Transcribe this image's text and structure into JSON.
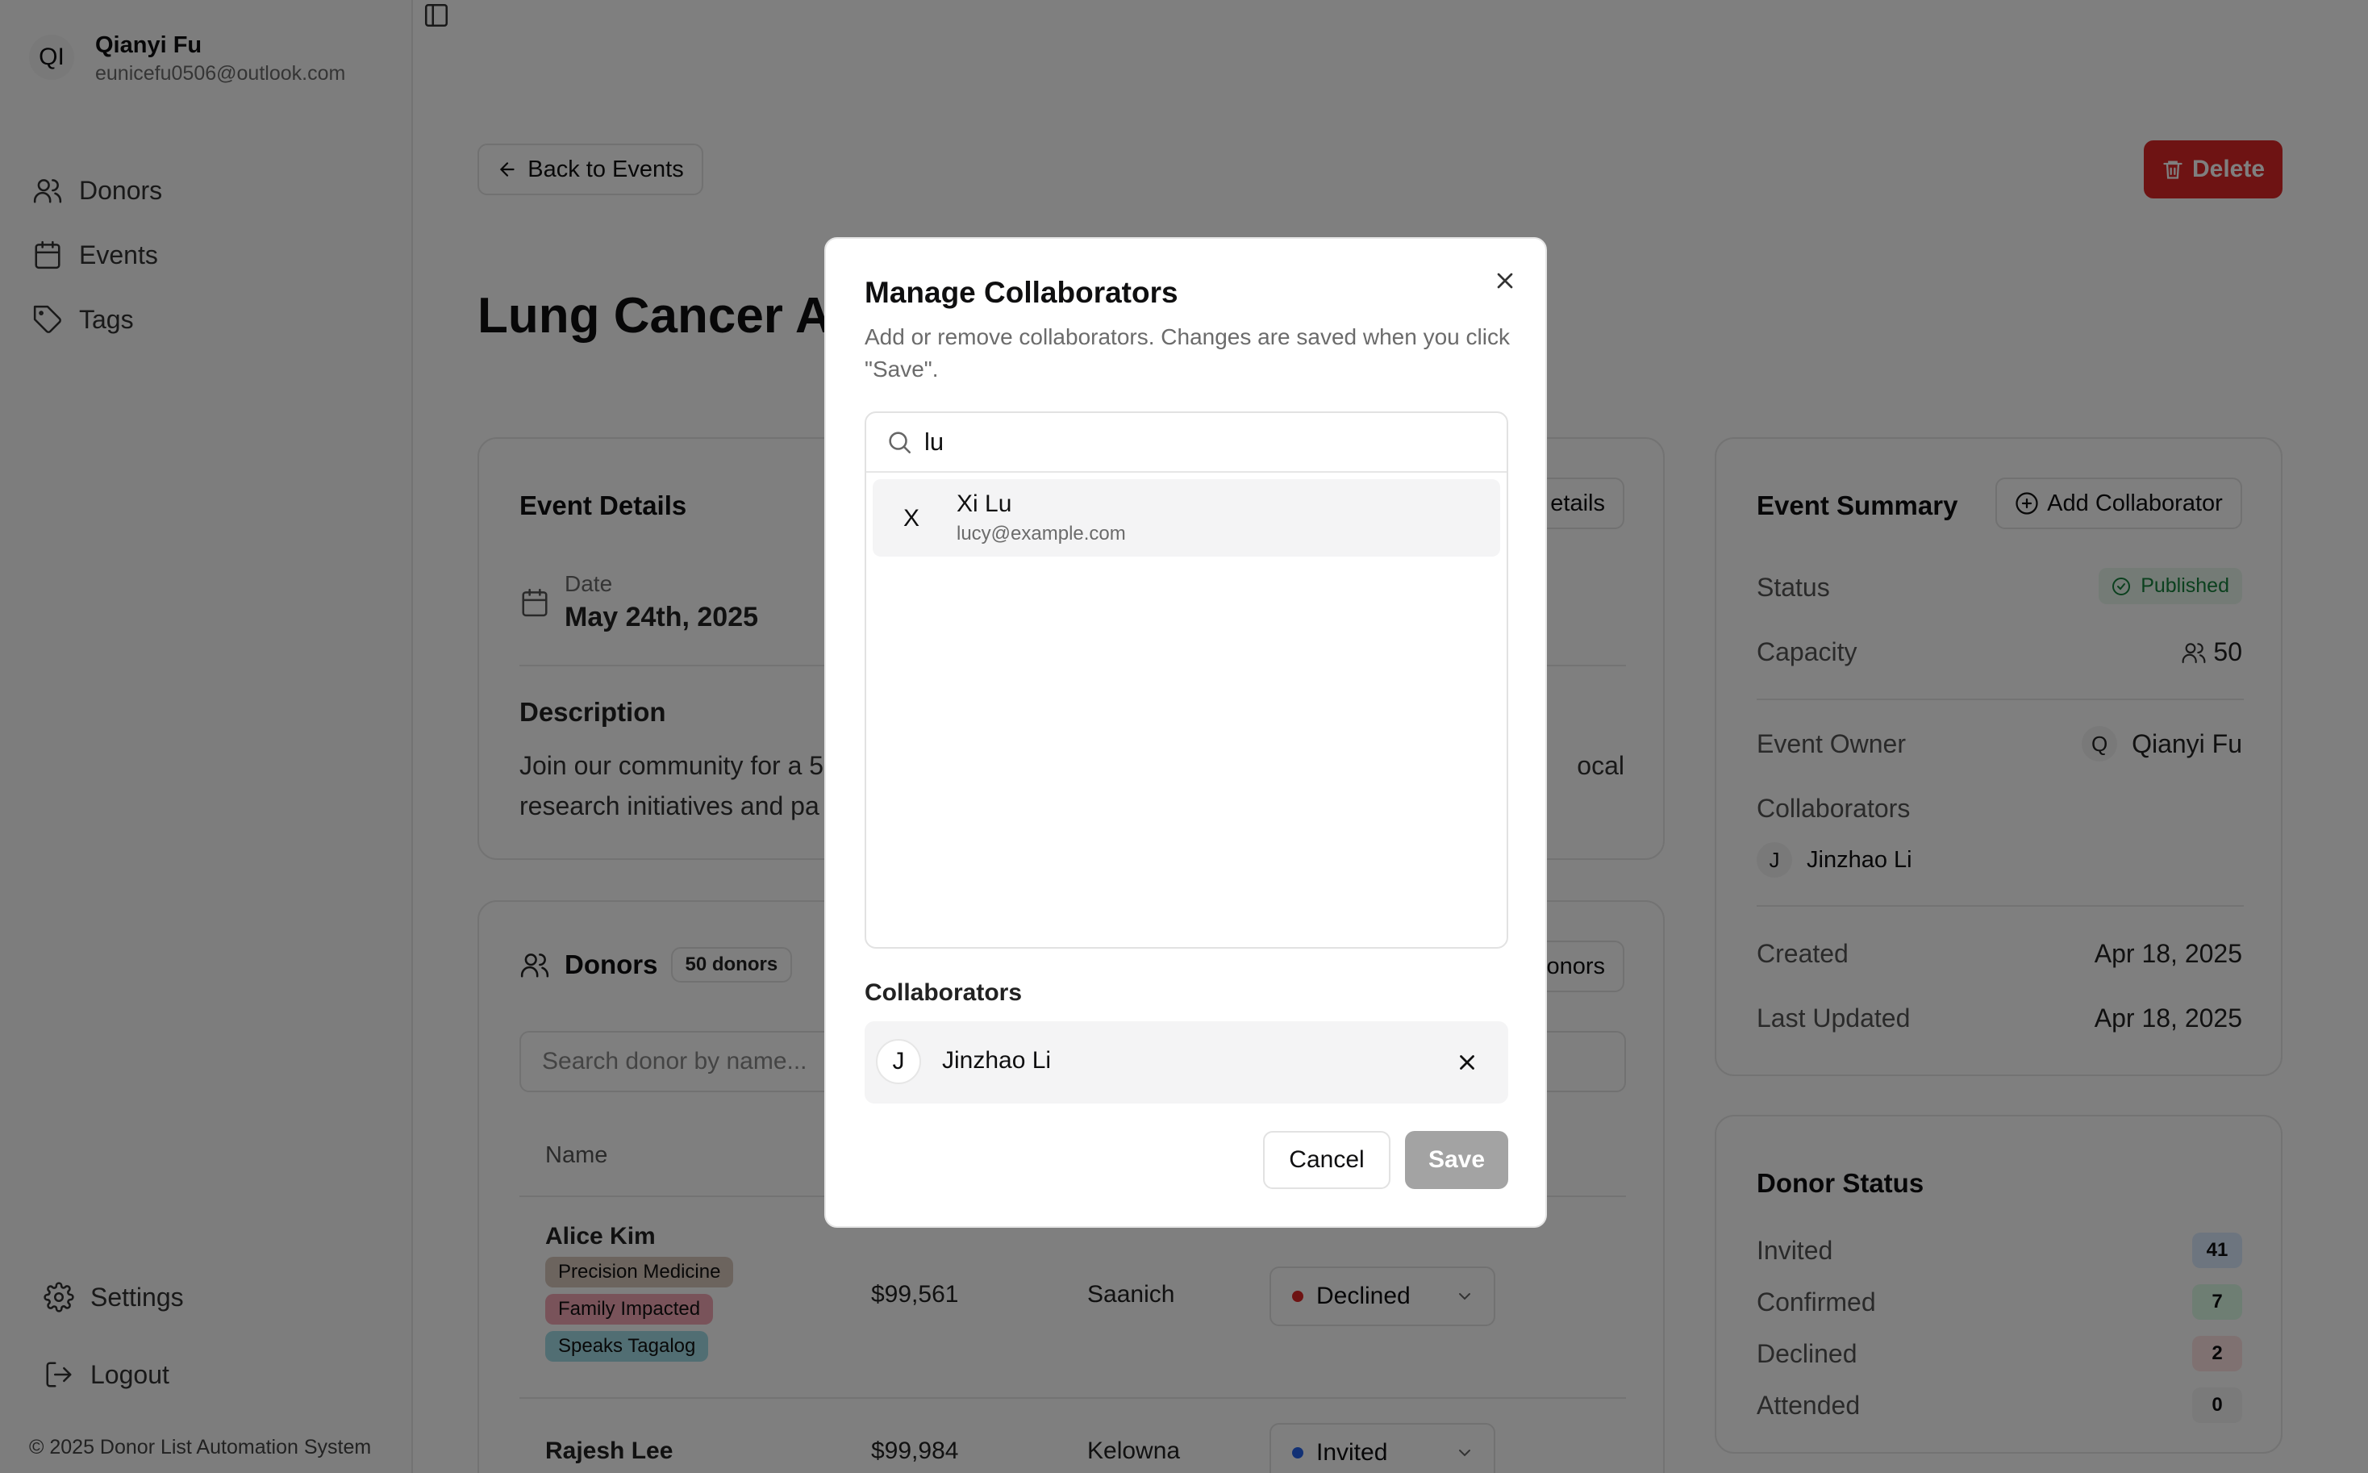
{
  "sidebar": {
    "user": {
      "initials": "QI",
      "name": "Qianyi Fu",
      "email": "eunicefu0506@outlook.com"
    },
    "nav": [
      {
        "label": "Donors",
        "icon": "users-icon"
      },
      {
        "label": "Events",
        "icon": "calendar-icon"
      },
      {
        "label": "Tags",
        "icon": "tag-icon"
      }
    ],
    "bottom": [
      {
        "label": "Settings",
        "icon": "gear-icon"
      },
      {
        "label": "Logout",
        "icon": "logout-icon"
      }
    ],
    "copyright": "© 2025 Donor List Automation System"
  },
  "header": {
    "back_label": "Back to Events",
    "delete_label": "Delete",
    "page_title": "Lung Cancer Aw"
  },
  "details": {
    "title": "Event Details",
    "edit_label": "etails",
    "date_label": "Date",
    "date_value": "May 24th, 2025",
    "desc_title": "Description",
    "desc_line1_left": "Join our community for a 5",
    "desc_line1_right": "ocal",
    "desc_line2_left": "research initiatives and pa"
  },
  "donors": {
    "title": "Donors",
    "count": "50 donors",
    "add_label": "onors",
    "search_placeholder": "Search donor by name...",
    "col_name": "Name",
    "rows": [
      {
        "name": "Alice Kim",
        "tags": [
          "Precision Medicine",
          "Family Impacted",
          "Speaks Tagalog"
        ],
        "amount": "$99,561",
        "city": "Saanich",
        "status": "Declined"
      },
      {
        "name": "Rajesh Lee",
        "tags": [],
        "amount": "$99,984",
        "city": "Kelowna",
        "status": "Invited"
      }
    ]
  },
  "summary": {
    "title": "Event Summary",
    "add_collab_label": "Add Collaborator",
    "status_label": "Status",
    "status_value": "Published",
    "capacity_label": "Capacity",
    "capacity_value": "50",
    "owner_label": "Event Owner",
    "owner_initial": "Q",
    "owner_name": "Qianyi Fu",
    "collab_label": "Collaborators",
    "collab_initial": "J",
    "collab_name": "Jinzhao Li",
    "created_label": "Created",
    "created_value": "Apr 18, 2025",
    "updated_label": "Last Updated",
    "updated_value": "Apr 18, 2025"
  },
  "donor_status": {
    "title": "Donor Status",
    "items": [
      {
        "label": "Invited",
        "value": "41"
      },
      {
        "label": "Confirmed",
        "value": "7"
      },
      {
        "label": "Declined",
        "value": "2"
      },
      {
        "label": "Attended",
        "value": "0"
      }
    ]
  },
  "modal": {
    "title": "Manage Collaborators",
    "description": "Add or remove collaborators. Changes are saved when you click \"Save\".",
    "search_value": "lu",
    "option": {
      "initial": "X",
      "name": "Xi Lu",
      "email": "lucy@example.com"
    },
    "collab_section": "Collaborators",
    "collaborator": {
      "initial": "J",
      "name": "Jinzhao Li"
    },
    "cancel_label": "Cancel",
    "save_label": "Save"
  },
  "colors": {
    "accent_danger": "#dc2626",
    "published_bg": "#e8f6ec",
    "published_fg": "#16803c",
    "declined_dot": "#dc2626",
    "invited_dot": "#2563eb",
    "tag_precision": "#d8c8bd",
    "tag_family": "#f3a7b4",
    "tag_tagalog": "#a3dde6"
  }
}
